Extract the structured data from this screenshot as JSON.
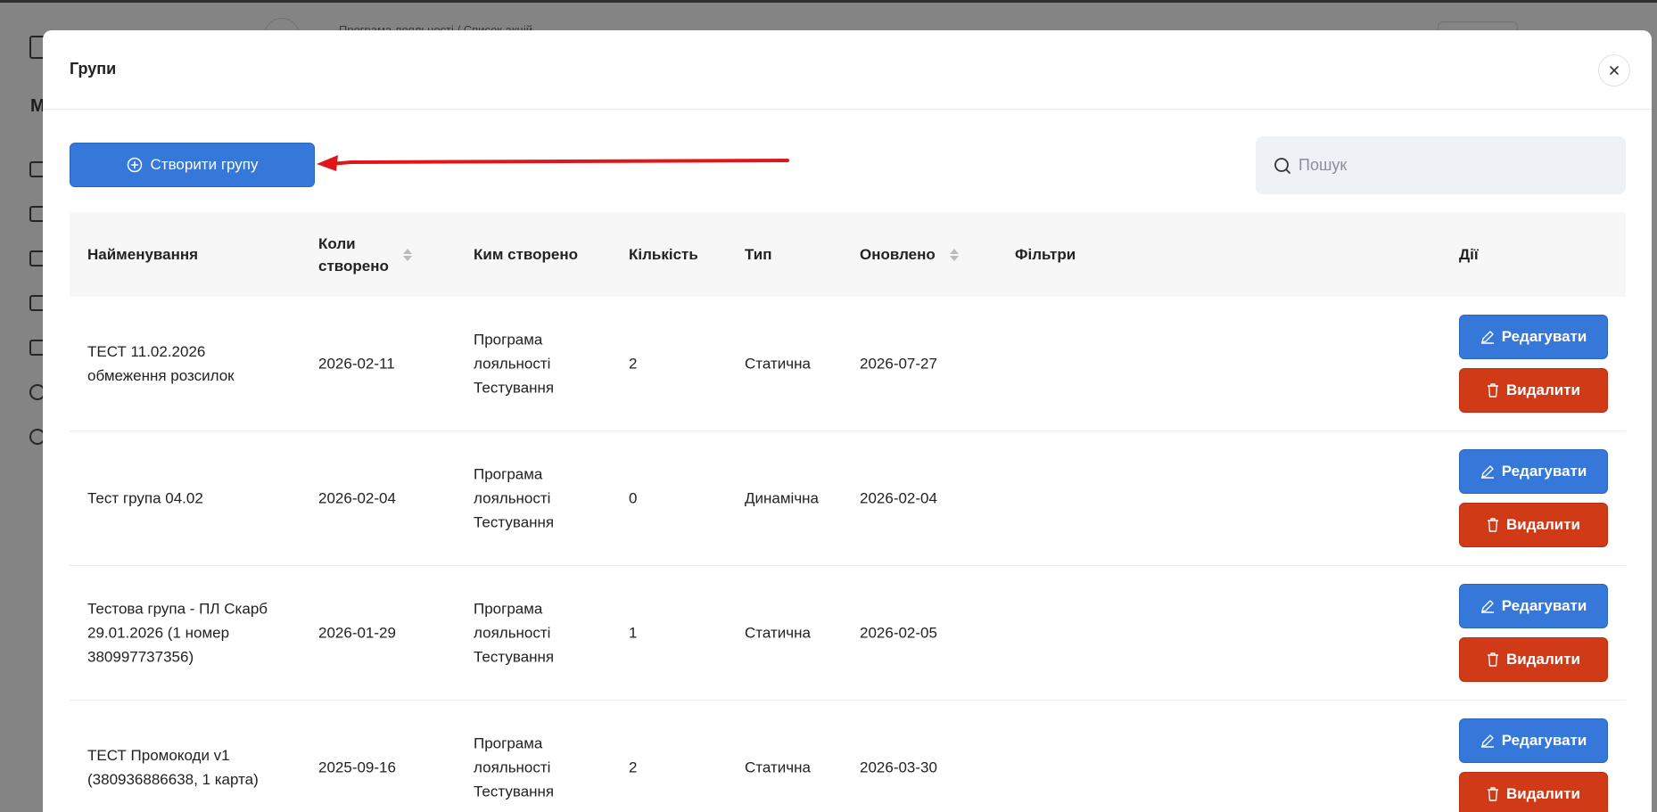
{
  "background": {
    "letter": "М",
    "breadcrumb": "Програма лояльності / Список акцій"
  },
  "modal": {
    "title": "Групи",
    "close_label": "×"
  },
  "toolbar": {
    "create_label": "Створити групу",
    "search_placeholder": "Пошук"
  },
  "table": {
    "headers": {
      "name": "Найменування",
      "created_line1": "Коли",
      "created_line2": "створено",
      "author": "Ким створено",
      "count": "Кількість",
      "type": "Тип",
      "updated": "Оновлено",
      "filters": "Фільтри",
      "actions": "Дії"
    },
    "rows": [
      {
        "name_line1": "ТЕСТ 11.02.2026",
        "name_line2": "обмеження розсилок",
        "name_line3": "",
        "created": "2026-02-11",
        "author_line1": "Програма",
        "author_line2": "лояльності",
        "author_line3": "Тестування",
        "count": "2",
        "type": "Статична",
        "updated": "2026-07-27"
      },
      {
        "name_line1": "Тест група 04.02",
        "name_line2": "",
        "name_line3": "",
        "created": "2026-02-04",
        "author_line1": "Програма",
        "author_line2": "лояльності",
        "author_line3": "Тестування",
        "count": "0",
        "type": "Динамічна",
        "updated": "2026-02-04"
      },
      {
        "name_line1": "Тестова група - ПЛ Скарб",
        "name_line2": "29.01.2026 (1 номер",
        "name_line3": "380997737356)",
        "created": "2026-01-29",
        "author_line1": "Програма",
        "author_line2": "лояльності",
        "author_line3": "Тестування",
        "count": "1",
        "type": "Статична",
        "updated": "2026-02-05"
      },
      {
        "name_line1": "ТЕСТ Промокоди v1",
        "name_line2": "(380936886638, 1 карта)",
        "name_line3": "",
        "created": "2025-09-16",
        "author_line1": "Програма",
        "author_line2": "лояльності",
        "author_line3": "Тестування",
        "count": "2",
        "type": "Статична",
        "updated": "2026-03-30"
      }
    ],
    "edit_label": "Редагувати",
    "delete_label": "Видалити"
  },
  "colors": {
    "primary": "#3578d9",
    "danger": "#d03a17",
    "annotation_arrow": "#e0161b"
  },
  "icons": {
    "create": "plus-circle-icon",
    "search": "search-icon",
    "edit": "pencil-icon",
    "delete": "trash-icon",
    "close": "close-icon"
  }
}
